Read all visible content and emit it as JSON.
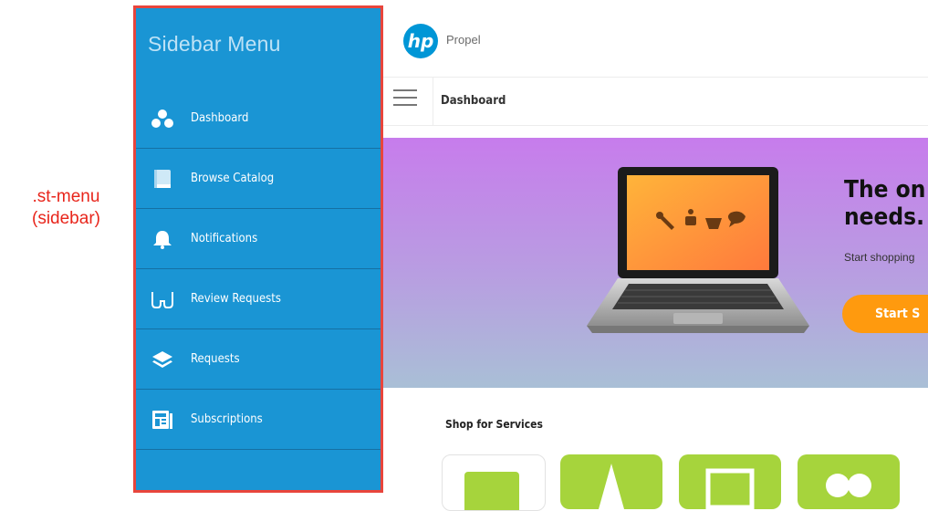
{
  "annotation": {
    "line1": ".st-menu",
    "line2": "(sidebar)"
  },
  "sidebar": {
    "title": "Sidebar Menu",
    "items": [
      {
        "label": "Dashboard",
        "icon": "dots-icon"
      },
      {
        "label": "Browse Catalog",
        "icon": "book-icon"
      },
      {
        "label": "Notifications",
        "icon": "bell-icon"
      },
      {
        "label": "Review Requests",
        "icon": "glasses-icon"
      },
      {
        "label": "Requests",
        "icon": "layers-icon"
      },
      {
        "label": "Subscriptions",
        "icon": "newspaper-icon"
      }
    ]
  },
  "header": {
    "logo_text": "hp",
    "brand": "Propel"
  },
  "nav": {
    "breadcrumb": "Dashboard"
  },
  "hero": {
    "headline_line1": "The on",
    "headline_line2": "needs.",
    "subtext": "Start shopping",
    "button_label": "Start S"
  },
  "shop": {
    "title": "Shop for Services"
  },
  "colors": {
    "sidebar_bg": "#1a95d4",
    "sidebar_border": "#e8453c",
    "accent_orange": "#ff9a0e",
    "tile_green": "#a6d43c",
    "hp_blue": "#0096d6"
  }
}
